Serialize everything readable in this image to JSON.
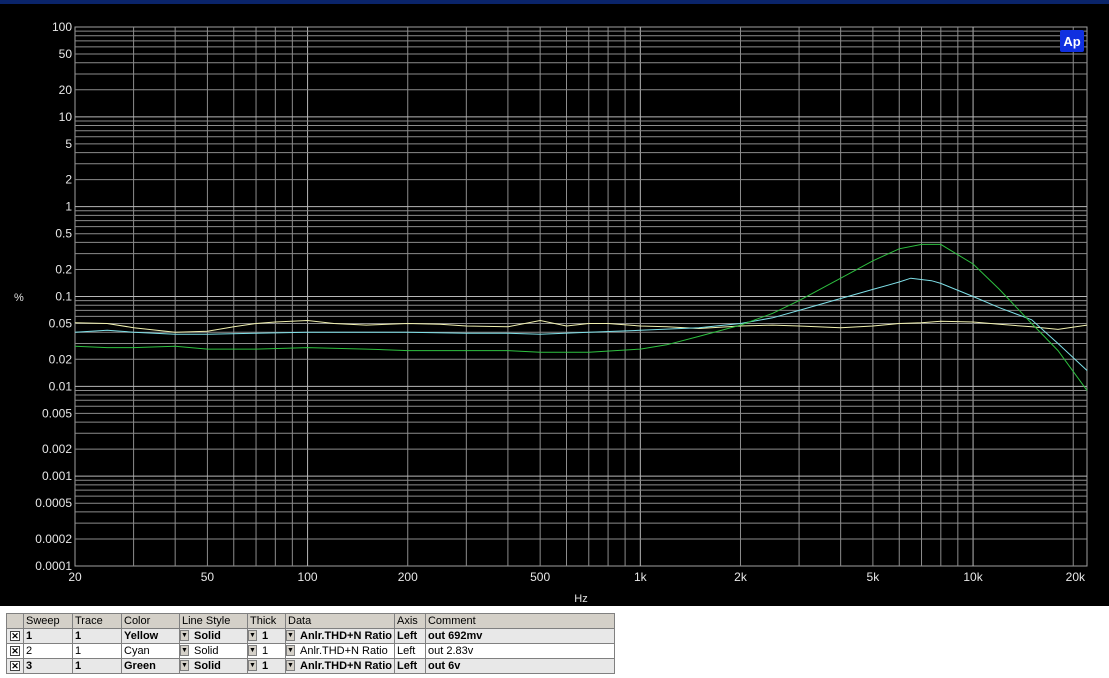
{
  "chart_data": {
    "type": "line",
    "title": "",
    "xlabel": "Hz",
    "ylabel": "%",
    "xscale": "log",
    "yscale": "log",
    "xlim": [
      20,
      22000
    ],
    "ylim": [
      0.0001,
      100
    ],
    "grid": true,
    "x_tick_labels": [
      {
        "v": 20,
        "t": "20"
      },
      {
        "v": 50,
        "t": "50"
      },
      {
        "v": 100,
        "t": "100"
      },
      {
        "v": 200,
        "t": "200"
      },
      {
        "v": 500,
        "t": "500"
      },
      {
        "v": 1000,
        "t": "1k"
      },
      {
        "v": 2000,
        "t": "2k"
      },
      {
        "v": 5000,
        "t": "5k"
      },
      {
        "v": 10000,
        "t": "10k"
      },
      {
        "v": 20000,
        "t": "20k"
      }
    ],
    "y_tick_labels": [
      {
        "v": 100,
        "t": "100"
      },
      {
        "v": 50,
        "t": "50"
      },
      {
        "v": 20,
        "t": "20"
      },
      {
        "v": 10,
        "t": "10"
      },
      {
        "v": 5,
        "t": "5"
      },
      {
        "v": 2,
        "t": "2"
      },
      {
        "v": 1,
        "t": "1"
      },
      {
        "v": 0.5,
        "t": "0.5"
      },
      {
        "v": 0.2,
        "t": "0.2"
      },
      {
        "v": 0.1,
        "t": "0.1"
      },
      {
        "v": 0.05,
        "t": "0.05"
      },
      {
        "v": 0.02,
        "t": "0.02"
      },
      {
        "v": 0.01,
        "t": "0.01"
      },
      {
        "v": 0.005,
        "t": "0.005"
      },
      {
        "v": 0.002,
        "t": "0.002"
      },
      {
        "v": 0.001,
        "t": "0.001"
      },
      {
        "v": 0.0005,
        "t": "0.0005"
      },
      {
        "v": 0.0002,
        "t": "0.0002"
      },
      {
        "v": 0.0001,
        "t": "0.0001"
      }
    ],
    "series": [
      {
        "color": "#f0f0b0",
        "x": [
          20,
          25,
          30,
          40,
          50,
          60,
          70,
          80,
          100,
          120,
          150,
          200,
          250,
          300,
          400,
          500,
          600,
          700,
          800,
          1000,
          1200,
          1500,
          2000,
          2500,
          3000,
          4000,
          5000,
          6000,
          7000,
          8000,
          10000,
          12000,
          15000,
          18000,
          22000
        ],
        "y": [
          0.051,
          0.05,
          0.045,
          0.04,
          0.041,
          0.046,
          0.05,
          0.052,
          0.054,
          0.05,
          0.048,
          0.05,
          0.049,
          0.047,
          0.046,
          0.054,
          0.047,
          0.05,
          0.05,
          0.047,
          0.046,
          0.044,
          0.047,
          0.048,
          0.047,
          0.045,
          0.047,
          0.05,
          0.051,
          0.053,
          0.052,
          0.049,
          0.046,
          0.043,
          0.048
        ]
      },
      {
        "color": "#7fe0e8",
        "x": [
          20,
          25,
          30,
          40,
          50,
          70,
          100,
          150,
          200,
          300,
          400,
          500,
          700,
          1000,
          1500,
          2000,
          2500,
          3000,
          4000,
          5000,
          6000,
          6500,
          7500,
          8000,
          10000,
          12000,
          15000,
          18000,
          22000
        ],
        "y": [
          0.04,
          0.042,
          0.04,
          0.038,
          0.038,
          0.039,
          0.04,
          0.04,
          0.04,
          0.039,
          0.039,
          0.038,
          0.04,
          0.042,
          0.045,
          0.05,
          0.058,
          0.07,
          0.095,
          0.12,
          0.145,
          0.16,
          0.15,
          0.14,
          0.1,
          0.075,
          0.055,
          0.03,
          0.015
        ]
      },
      {
        "color": "#2ec040",
        "x": [
          20,
          25,
          30,
          40,
          50,
          70,
          100,
          150,
          200,
          300,
          400,
          500,
          700,
          1000,
          1200,
          1500,
          2000,
          2500,
          3000,
          4000,
          5000,
          6000,
          7000,
          8000,
          10000,
          12000,
          15000,
          18000,
          22000
        ],
        "y": [
          0.028,
          0.027,
          0.027,
          0.028,
          0.026,
          0.026,
          0.027,
          0.026,
          0.025,
          0.025,
          0.025,
          0.024,
          0.024,
          0.026,
          0.029,
          0.036,
          0.048,
          0.065,
          0.09,
          0.16,
          0.25,
          0.34,
          0.38,
          0.38,
          0.23,
          0.12,
          0.05,
          0.025,
          0.009
        ]
      }
    ]
  },
  "logo": {
    "text": "Ap",
    "color": "#1030e0"
  },
  "table": {
    "headers": [
      "",
      "Sweep",
      "Trace",
      "Color",
      "Line Style",
      "Thick",
      "Data",
      "Axis",
      "Comment"
    ],
    "rows": [
      {
        "check": "✕",
        "sweep": "1",
        "trace": "1",
        "color": "Yellow",
        "line_style": "Solid",
        "thick": "1",
        "data": "Anlr.THD+N Ratio",
        "axis": "Left",
        "comment": "out 692mv"
      },
      {
        "check": "✕",
        "sweep": "2",
        "trace": "1",
        "color": "Cyan",
        "line_style": "Solid",
        "thick": "1",
        "data": "Anlr.THD+N Ratio",
        "axis": "Left",
        "comment": "out 2.83v"
      },
      {
        "check": "✕",
        "sweep": "3",
        "trace": "1",
        "color": "Green",
        "line_style": "Solid",
        "thick": "1",
        "data": "Anlr.THD+N Ratio",
        "axis": "Left",
        "comment": "out 6v"
      }
    ]
  }
}
